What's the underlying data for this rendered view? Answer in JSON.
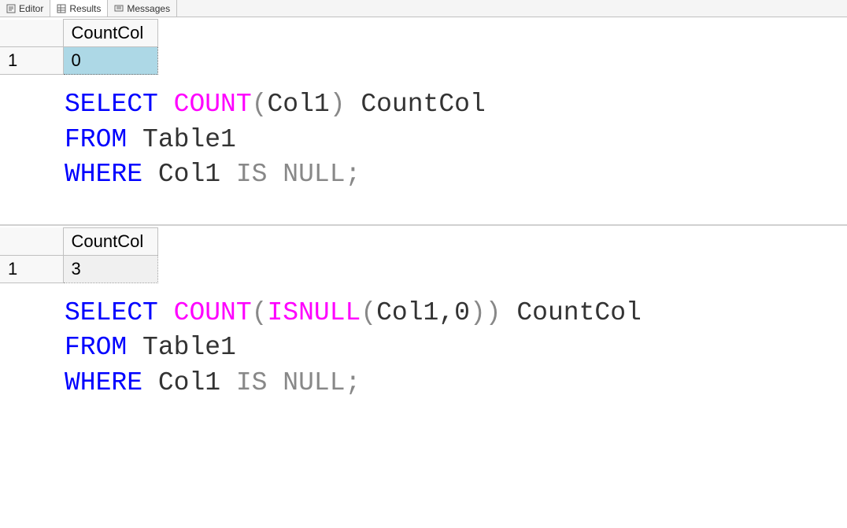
{
  "tabs": {
    "editor": "Editor",
    "results": "Results",
    "messages": "Messages"
  },
  "block1": {
    "header": "CountCol",
    "rownum": "1",
    "value": "0",
    "sql": {
      "select": "SELECT",
      "count": "COUNT",
      "lp1": "(",
      "col1": "Col1",
      "rp1": ")",
      "alias": " CountCol",
      "from": "FROM",
      "table": " Table1",
      "where": "WHERE",
      "col1b": " Col1 ",
      "is": "IS",
      "sp": " ",
      "null": "NULL",
      "semi": ";"
    }
  },
  "block2": {
    "header": "CountCol",
    "rownum": "1",
    "value": "3",
    "sql": {
      "select": "SELECT",
      "count": "COUNT",
      "lp1": "(",
      "isnull": "ISNULL",
      "lp2": "(",
      "args": "Col1,0",
      "rp2": ")",
      "rp1": ")",
      "alias": " CountCol",
      "from": "FROM",
      "table": " Table1",
      "where": "WHERE",
      "col1b": " Col1 ",
      "is": "IS",
      "sp": " ",
      "null": "NULL",
      "semi": ";"
    }
  }
}
